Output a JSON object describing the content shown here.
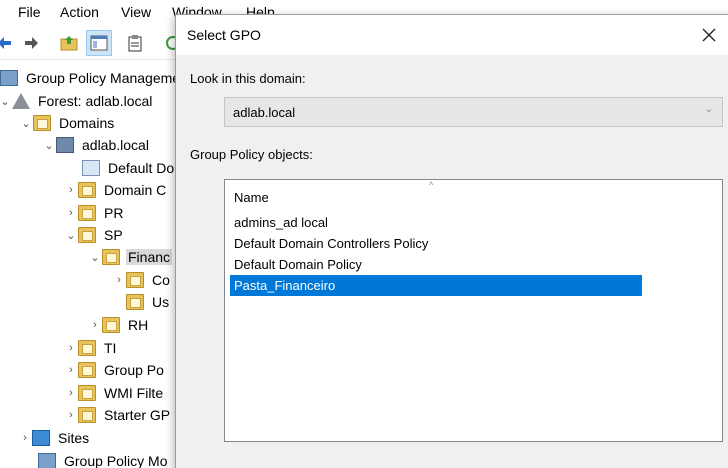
{
  "menu": [
    "File",
    "Action",
    "View",
    "Window",
    "Help"
  ],
  "toolbar": {
    "buttons": [
      "back-icon",
      "forward-icon",
      "up-folder-icon",
      "show-tree-icon",
      "properties-icon",
      "refresh-icon"
    ]
  },
  "tree": {
    "items": [
      {
        "label": "Group Policy Manageme",
        "icon": "gpm-icon",
        "chevron": ""
      },
      {
        "label": "Forest: adlab.local",
        "icon": "forest-icon",
        "chevron": "v"
      },
      {
        "label": "Domains",
        "icon": "folder-icon",
        "chevron": "v"
      },
      {
        "label": "adlab.local",
        "icon": "domain-icon",
        "chevron": "v"
      },
      {
        "label": "Default Do",
        "icon": "gpo-link-icon",
        "chevron": ""
      },
      {
        "label": "Domain C",
        "icon": "folder-icon",
        "chevron": ">"
      },
      {
        "label": "PR",
        "icon": "folder-icon",
        "chevron": ">"
      },
      {
        "label": "SP",
        "icon": "folder-icon",
        "chevron": "v"
      },
      {
        "label": "Financ",
        "icon": "folder-icon",
        "chevron": "v"
      },
      {
        "label": "Co",
        "icon": "folder-icon",
        "chevron": ">"
      },
      {
        "label": "Us",
        "icon": "folder-icon",
        "chevron": ""
      },
      {
        "label": "RH",
        "icon": "folder-icon",
        "chevron": ">"
      },
      {
        "label": "TI",
        "icon": "folder-icon",
        "chevron": ">"
      },
      {
        "label": "Group Po",
        "icon": "folder-icon",
        "chevron": ">"
      },
      {
        "label": "WMI Filte",
        "icon": "folder-icon",
        "chevron": ">"
      },
      {
        "label": "Starter GP",
        "icon": "folder-icon",
        "chevron": ">"
      },
      {
        "label": "Sites",
        "icon": "sites-icon",
        "chevron": ">"
      },
      {
        "label": "Group Policy Mo",
        "icon": "gpm-icon",
        "chevron": ""
      }
    ]
  },
  "dialog": {
    "title": "Select GPO",
    "domain_label": "Look in this domain:",
    "domain_value": "adlab.local",
    "objects_label": "Group Policy objects:",
    "column_name": "Name",
    "rows": [
      "admins_ad local",
      "Default Domain Controllers Policy",
      "Default Domain Policy",
      "Pasta_Financeiro"
    ],
    "selected_index": 3
  },
  "colors": {
    "selection": "#0078d7",
    "dialog_bg": "#f0f0f0"
  }
}
